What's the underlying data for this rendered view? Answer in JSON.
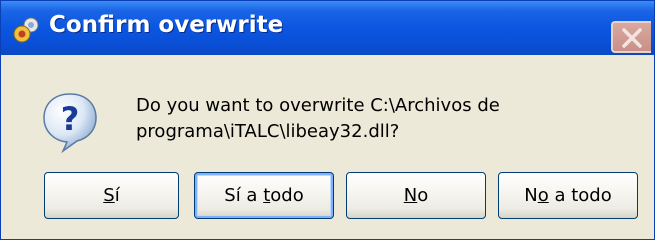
{
  "window": {
    "title": "Confirm overwrite"
  },
  "message": {
    "line1": "Do you want to overwrite C:\\Archivos de",
    "line2": "programa\\iTALC\\libeay32.dll?"
  },
  "buttons": {
    "yes": {
      "label": "Sí",
      "mnemonic": "S"
    },
    "yes_to_all": {
      "label": "Sí a todo",
      "mnemonic": "t"
    },
    "no": {
      "label": "No",
      "mnemonic": "N"
    },
    "no_to_all": {
      "label": "No a todo",
      "mnemonic": "o"
    }
  },
  "icons": {
    "title": "app-icon",
    "close": "close-icon",
    "message": "question-icon"
  },
  "colors": {
    "titlebar": "#0b56e0",
    "dialog_background": "#ece9d8",
    "button_border": "#003c74"
  }
}
